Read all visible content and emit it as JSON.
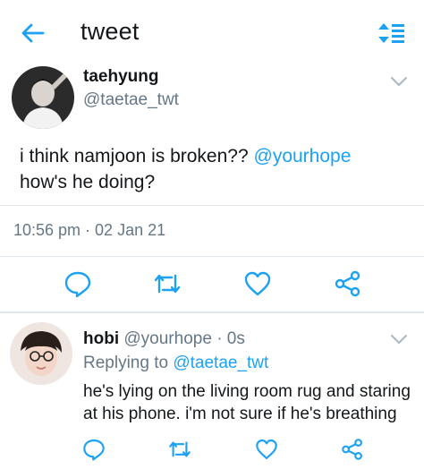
{
  "header": {
    "title": "tweet",
    "back_icon": "arrow-left-icon",
    "sort_icon": "sort-icon",
    "accent": "#1da1f2"
  },
  "main_tweet": {
    "name": "taehyung",
    "handle": "@taetae_twt",
    "text_before": "i think namjoon is broken?? ",
    "mention": "@yourhope",
    "text_after": "how's he doing?",
    "timestamp": "10:56 pm · 02 Jan 21",
    "actions": [
      "reply-icon",
      "retweet-icon",
      "like-icon",
      "share-icon"
    ]
  },
  "reply": {
    "name": "hobi",
    "handle": "@yourhope",
    "time": " · 0s",
    "replying_prefix": "Replying to ",
    "replying_to": "@taetae_twt",
    "text": "he's lying on the living room rug and staring at his phone. i'm not sure if he's breathing",
    "actions": [
      "reply-icon",
      "retweet-icon",
      "like-icon",
      "share-icon"
    ]
  },
  "colors": {
    "text": "#14171a",
    "secondary": "#657786",
    "link": "#1da1f2",
    "divider": "#e1e8ed"
  }
}
